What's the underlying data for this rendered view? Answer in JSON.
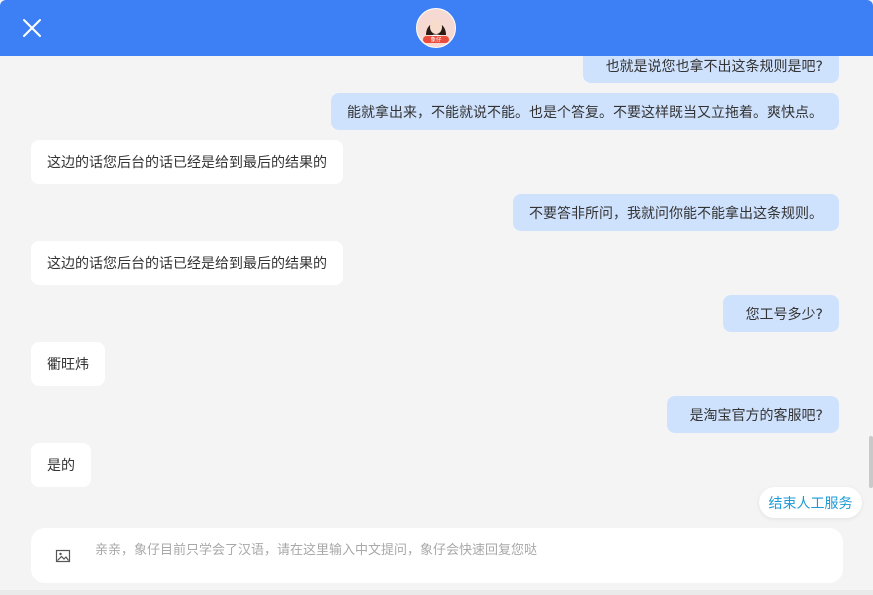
{
  "header": {
    "close_icon": "close-icon",
    "avatar_badge": "象仔"
  },
  "messages": [
    {
      "role": "user",
      "text": "也就是说您也拿不出这条规则是吧?"
    },
    {
      "role": "user",
      "text": "能就拿出来，不能就说不能。也是个答复。不要这样既当又立拖着。爽快点。"
    },
    {
      "role": "agent",
      "text": "这边的话您后台的话已经是给到最后的结果的"
    },
    {
      "role": "user",
      "text": "不要答非所问，我就问你能不能拿出这条规则。"
    },
    {
      "role": "agent",
      "text": "这边的话您后台的话已经是给到最后的结果的"
    },
    {
      "role": "user",
      "text": "您工号多少?"
    },
    {
      "role": "agent",
      "text": "衢旺炜"
    },
    {
      "role": "user",
      "text": "是淘宝官方的客服吧?"
    },
    {
      "role": "agent",
      "text": "是的"
    }
  ],
  "end_service_label": "结束人工服务",
  "input": {
    "value": "",
    "placeholder": "亲亲，象仔目前只学会了汉语，请在这里输入中文提问，象仔会快速回复您哒",
    "image_icon": "image-icon"
  },
  "colors": {
    "header": "#3d7ff5",
    "user_bubble": "#cfe2fd",
    "agent_bubble": "#ffffff",
    "end_service_text": "#1e9bd7",
    "background": "#f4f4f4"
  }
}
